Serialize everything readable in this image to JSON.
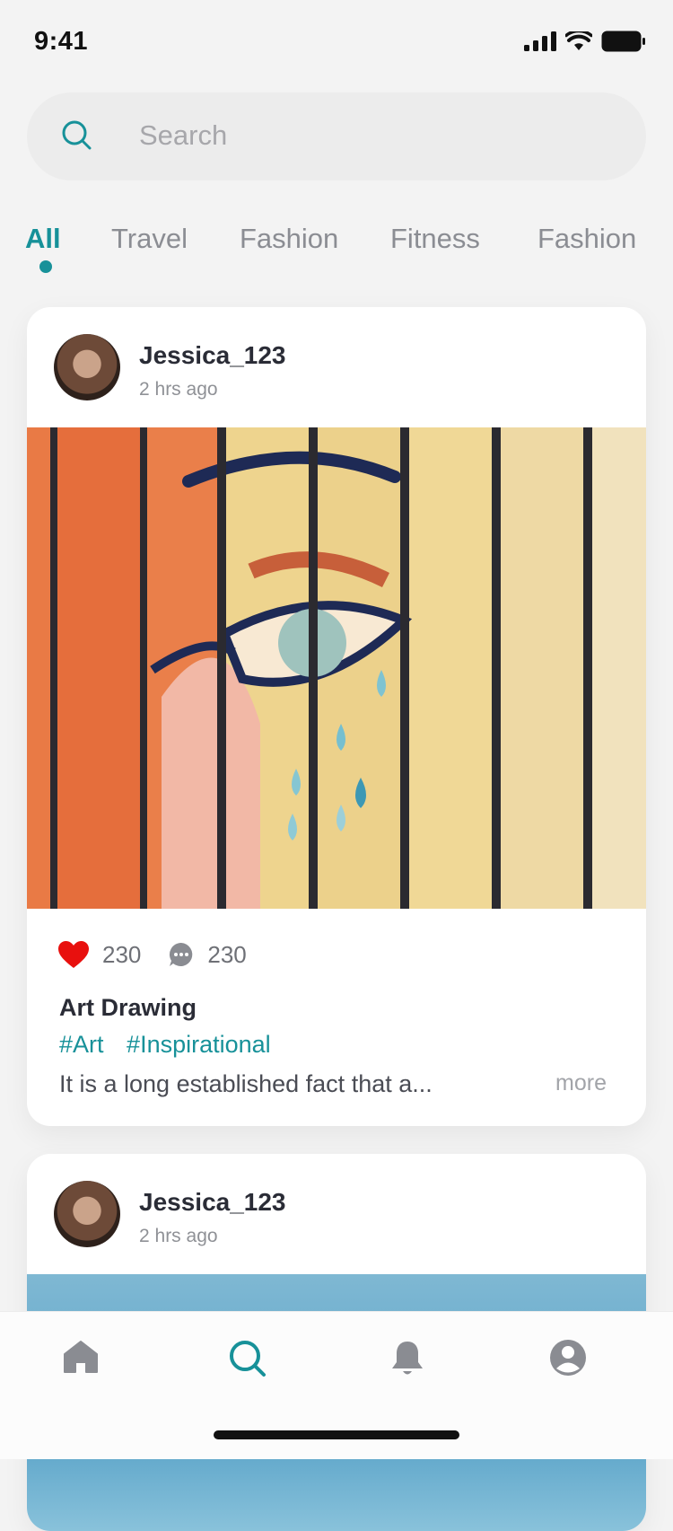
{
  "status_bar": {
    "time": "9:41"
  },
  "search": {
    "placeholder": "Search"
  },
  "tabs": [
    {
      "label": "All",
      "active": true
    },
    {
      "label": "Travel",
      "active": false
    },
    {
      "label": "Fashion",
      "active": false
    },
    {
      "label": "Fitness",
      "active": false
    },
    {
      "label": "Fashion",
      "active": false
    }
  ],
  "posts": [
    {
      "username": "Jessica_123",
      "time_ago": "2 hrs ago",
      "likes": "230",
      "comments": "230",
      "title": "Art Drawing",
      "hashtags": [
        "#Art",
        "#Inspirational"
      ],
      "caption": "It is a long established fact that a...",
      "more_label": "more"
    },
    {
      "username": "Jessica_123",
      "time_ago": "2 hrs ago"
    }
  ],
  "bottom_nav": {
    "items": [
      {
        "icon": "home-icon",
        "active": false
      },
      {
        "icon": "search-icon",
        "active": true
      },
      {
        "icon": "bell-icon",
        "active": false
      },
      {
        "icon": "profile-icon",
        "active": false
      }
    ]
  },
  "colors": {
    "accent": "#179199",
    "like": "#e8100e",
    "background": "#f3f3f3"
  }
}
